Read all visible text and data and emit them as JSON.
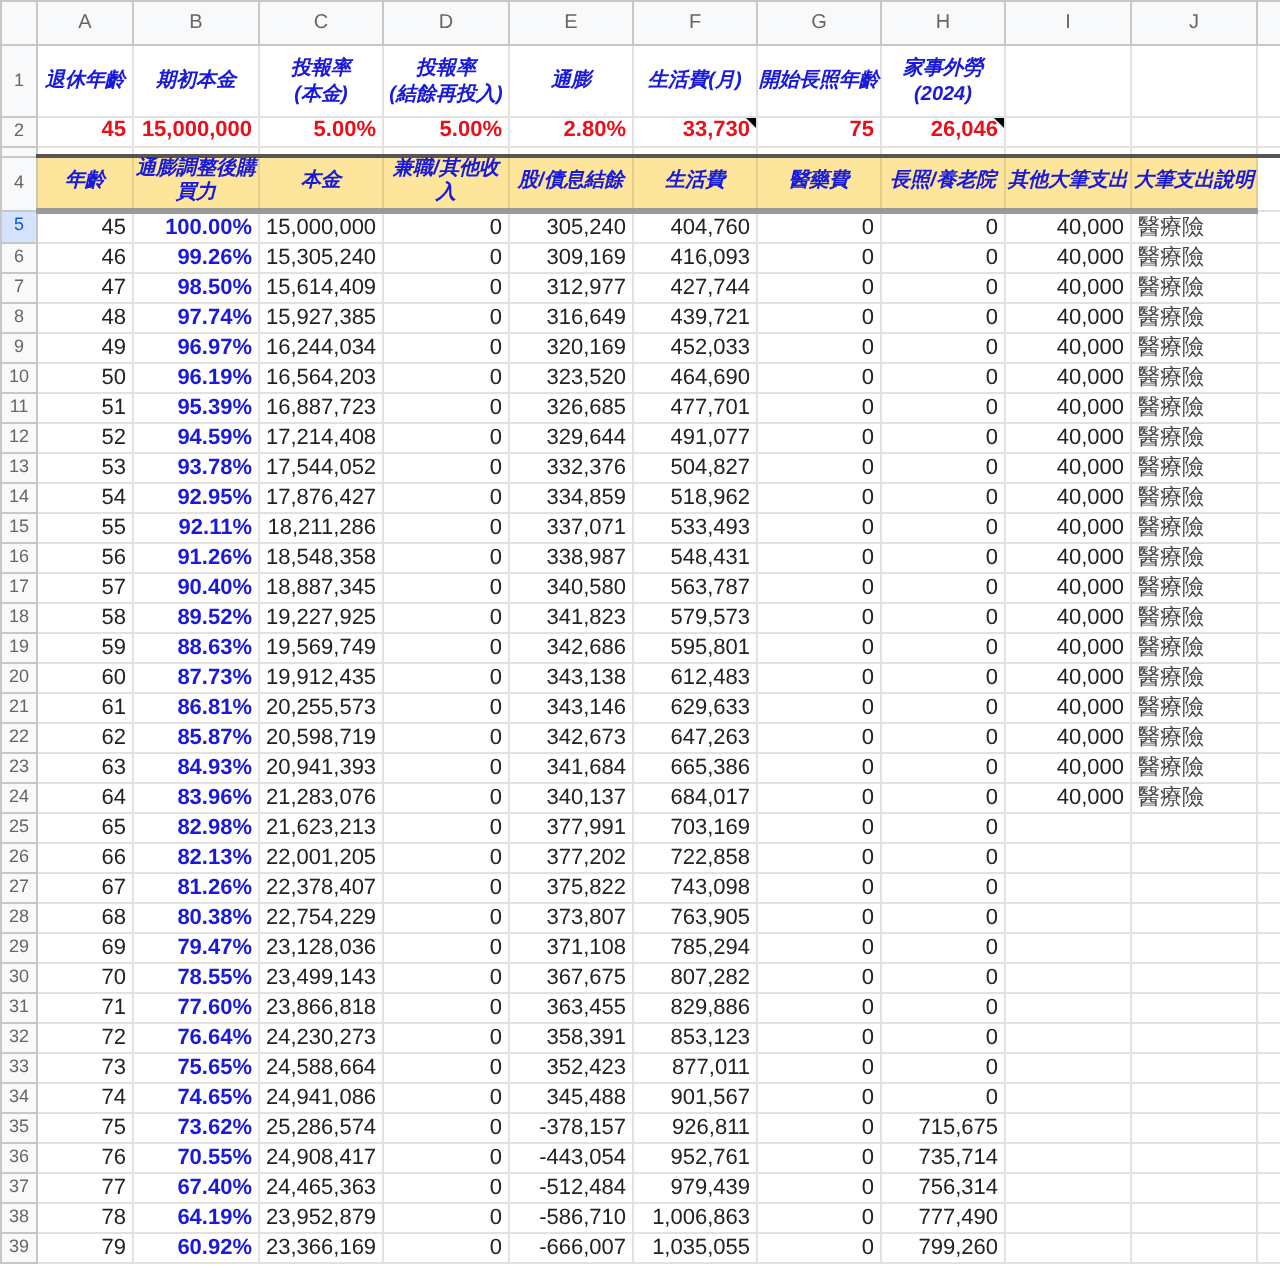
{
  "column_letters": [
    "A",
    "B",
    "C",
    "D",
    "E",
    "F",
    "G",
    "H",
    "I",
    "J"
  ],
  "parameters": {
    "label_row": "1",
    "value_row": "2",
    "labels": [
      "退休年齡",
      "期初本金",
      "投報率\n(本金)",
      "投報率\n(結餘再投入)",
      "通膨",
      "生活費(月)",
      "開始長照年齡",
      "家事外勞\n(2024)"
    ],
    "values": [
      {
        "text": "45",
        "has_note": false
      },
      {
        "text": "15,000,000",
        "has_note": false
      },
      {
        "text": "5.00%",
        "has_note": false
      },
      {
        "text": "5.00%",
        "has_note": false
      },
      {
        "text": "2.80%",
        "has_note": false
      },
      {
        "text": "33,730",
        "has_note": true
      },
      {
        "text": "75",
        "has_note": false
      },
      {
        "text": "26,046",
        "has_note": true
      }
    ]
  },
  "table": {
    "header_row": "4",
    "columns": [
      "年齡",
      "通膨調整後購買力",
      "本金",
      "兼職/其他收入",
      "股/債息結餘",
      "生活費",
      "醫藥費",
      "長照/養老院",
      "其他大筆支出",
      "大筆支出說明"
    ],
    "rows": [
      {
        "num": "5",
        "selected": true,
        "cells": [
          "45",
          "100.00%",
          "15,000,000",
          "0",
          "305,240",
          "404,760",
          "0",
          "0",
          "40,000",
          "醫療險"
        ]
      },
      {
        "num": "6",
        "selected": false,
        "cells": [
          "46",
          "99.26%",
          "15,305,240",
          "0",
          "309,169",
          "416,093",
          "0",
          "0",
          "40,000",
          "醫療險"
        ]
      },
      {
        "num": "7",
        "selected": false,
        "cells": [
          "47",
          "98.50%",
          "15,614,409",
          "0",
          "312,977",
          "427,744",
          "0",
          "0",
          "40,000",
          "醫療險"
        ]
      },
      {
        "num": "8",
        "selected": false,
        "cells": [
          "48",
          "97.74%",
          "15,927,385",
          "0",
          "316,649",
          "439,721",
          "0",
          "0",
          "40,000",
          "醫療險"
        ]
      },
      {
        "num": "9",
        "selected": false,
        "cells": [
          "49",
          "96.97%",
          "16,244,034",
          "0",
          "320,169",
          "452,033",
          "0",
          "0",
          "40,000",
          "醫療險"
        ]
      },
      {
        "num": "10",
        "selected": false,
        "cells": [
          "50",
          "96.19%",
          "16,564,203",
          "0",
          "323,520",
          "464,690",
          "0",
          "0",
          "40,000",
          "醫療險"
        ]
      },
      {
        "num": "11",
        "selected": false,
        "cells": [
          "51",
          "95.39%",
          "16,887,723",
          "0",
          "326,685",
          "477,701",
          "0",
          "0",
          "40,000",
          "醫療險"
        ]
      },
      {
        "num": "12",
        "selected": false,
        "cells": [
          "52",
          "94.59%",
          "17,214,408",
          "0",
          "329,644",
          "491,077",
          "0",
          "0",
          "40,000",
          "醫療險"
        ]
      },
      {
        "num": "13",
        "selected": false,
        "cells": [
          "53",
          "93.78%",
          "17,544,052",
          "0",
          "332,376",
          "504,827",
          "0",
          "0",
          "40,000",
          "醫療險"
        ]
      },
      {
        "num": "14",
        "selected": false,
        "cells": [
          "54",
          "92.95%",
          "17,876,427",
          "0",
          "334,859",
          "518,962",
          "0",
          "0",
          "40,000",
          "醫療險"
        ]
      },
      {
        "num": "15",
        "selected": false,
        "cells": [
          "55",
          "92.11%",
          "18,211,286",
          "0",
          "337,071",
          "533,493",
          "0",
          "0",
          "40,000",
          "醫療險"
        ]
      },
      {
        "num": "16",
        "selected": false,
        "cells": [
          "56",
          "91.26%",
          "18,548,358",
          "0",
          "338,987",
          "548,431",
          "0",
          "0",
          "40,000",
          "醫療險"
        ]
      },
      {
        "num": "17",
        "selected": false,
        "cells": [
          "57",
          "90.40%",
          "18,887,345",
          "0",
          "340,580",
          "563,787",
          "0",
          "0",
          "40,000",
          "醫療險"
        ]
      },
      {
        "num": "18",
        "selected": false,
        "cells": [
          "58",
          "89.52%",
          "19,227,925",
          "0",
          "341,823",
          "579,573",
          "0",
          "0",
          "40,000",
          "醫療險"
        ]
      },
      {
        "num": "19",
        "selected": false,
        "cells": [
          "59",
          "88.63%",
          "19,569,749",
          "0",
          "342,686",
          "595,801",
          "0",
          "0",
          "40,000",
          "醫療險"
        ]
      },
      {
        "num": "20",
        "selected": false,
        "cells": [
          "60",
          "87.73%",
          "19,912,435",
          "0",
          "343,138",
          "612,483",
          "0",
          "0",
          "40,000",
          "醫療險"
        ]
      },
      {
        "num": "21",
        "selected": false,
        "cells": [
          "61",
          "86.81%",
          "20,255,573",
          "0",
          "343,146",
          "629,633",
          "0",
          "0",
          "40,000",
          "醫療險"
        ]
      },
      {
        "num": "22",
        "selected": false,
        "cells": [
          "62",
          "85.87%",
          "20,598,719",
          "0",
          "342,673",
          "647,263",
          "0",
          "0",
          "40,000",
          "醫療險"
        ]
      },
      {
        "num": "23",
        "selected": false,
        "cells": [
          "63",
          "84.93%",
          "20,941,393",
          "0",
          "341,684",
          "665,386",
          "0",
          "0",
          "40,000",
          "醫療險"
        ]
      },
      {
        "num": "24",
        "selected": false,
        "cells": [
          "64",
          "83.96%",
          "21,283,076",
          "0",
          "340,137",
          "684,017",
          "0",
          "0",
          "40,000",
          "醫療險"
        ]
      },
      {
        "num": "25",
        "selected": false,
        "cells": [
          "65",
          "82.98%",
          "21,623,213",
          "0",
          "377,991",
          "703,169",
          "0",
          "0"
        ]
      },
      {
        "num": "26",
        "selected": false,
        "cells": [
          "66",
          "82.13%",
          "22,001,205",
          "0",
          "377,202",
          "722,858",
          "0",
          "0"
        ]
      },
      {
        "num": "27",
        "selected": false,
        "cells": [
          "67",
          "81.26%",
          "22,378,407",
          "0",
          "375,822",
          "743,098",
          "0",
          "0"
        ]
      },
      {
        "num": "28",
        "selected": false,
        "cells": [
          "68",
          "80.38%",
          "22,754,229",
          "0",
          "373,807",
          "763,905",
          "0",
          "0"
        ]
      },
      {
        "num": "29",
        "selected": false,
        "cells": [
          "69",
          "79.47%",
          "23,128,036",
          "0",
          "371,108",
          "785,294",
          "0",
          "0"
        ]
      },
      {
        "num": "30",
        "selected": false,
        "cells": [
          "70",
          "78.55%",
          "23,499,143",
          "0",
          "367,675",
          "807,282",
          "0",
          "0"
        ]
      },
      {
        "num": "31",
        "selected": false,
        "cells": [
          "71",
          "77.60%",
          "23,866,818",
          "0",
          "363,455",
          "829,886",
          "0",
          "0"
        ]
      },
      {
        "num": "32",
        "selected": false,
        "cells": [
          "72",
          "76.64%",
          "24,230,273",
          "0",
          "358,391",
          "853,123",
          "0",
          "0"
        ]
      },
      {
        "num": "33",
        "selected": false,
        "cells": [
          "73",
          "75.65%",
          "24,588,664",
          "0",
          "352,423",
          "877,011",
          "0",
          "0"
        ]
      },
      {
        "num": "34",
        "selected": false,
        "cells": [
          "74",
          "74.65%",
          "24,941,086",
          "0",
          "345,488",
          "901,567",
          "0",
          "0"
        ]
      },
      {
        "num": "35",
        "selected": false,
        "cells": [
          "75",
          "73.62%",
          "25,286,574",
          "0",
          "-378,157",
          "926,811",
          "0",
          "715,675"
        ]
      },
      {
        "num": "36",
        "selected": false,
        "cells": [
          "76",
          "70.55%",
          "24,908,417",
          "0",
          "-443,054",
          "952,761",
          "0",
          "735,714"
        ]
      },
      {
        "num": "37",
        "selected": false,
        "cells": [
          "77",
          "67.40%",
          "24,465,363",
          "0",
          "-512,484",
          "979,439",
          "0",
          "756,314"
        ]
      },
      {
        "num": "38",
        "selected": false,
        "cells": [
          "78",
          "64.19%",
          "23,952,879",
          "0",
          "-586,710",
          "1,006,863",
          "0",
          "777,490"
        ]
      },
      {
        "num": "39",
        "selected": false,
        "cells": [
          "79",
          "60.92%",
          "23,366,169",
          "0",
          "-666,007",
          "1,035,055",
          "0",
          "799,260"
        ]
      }
    ]
  }
}
